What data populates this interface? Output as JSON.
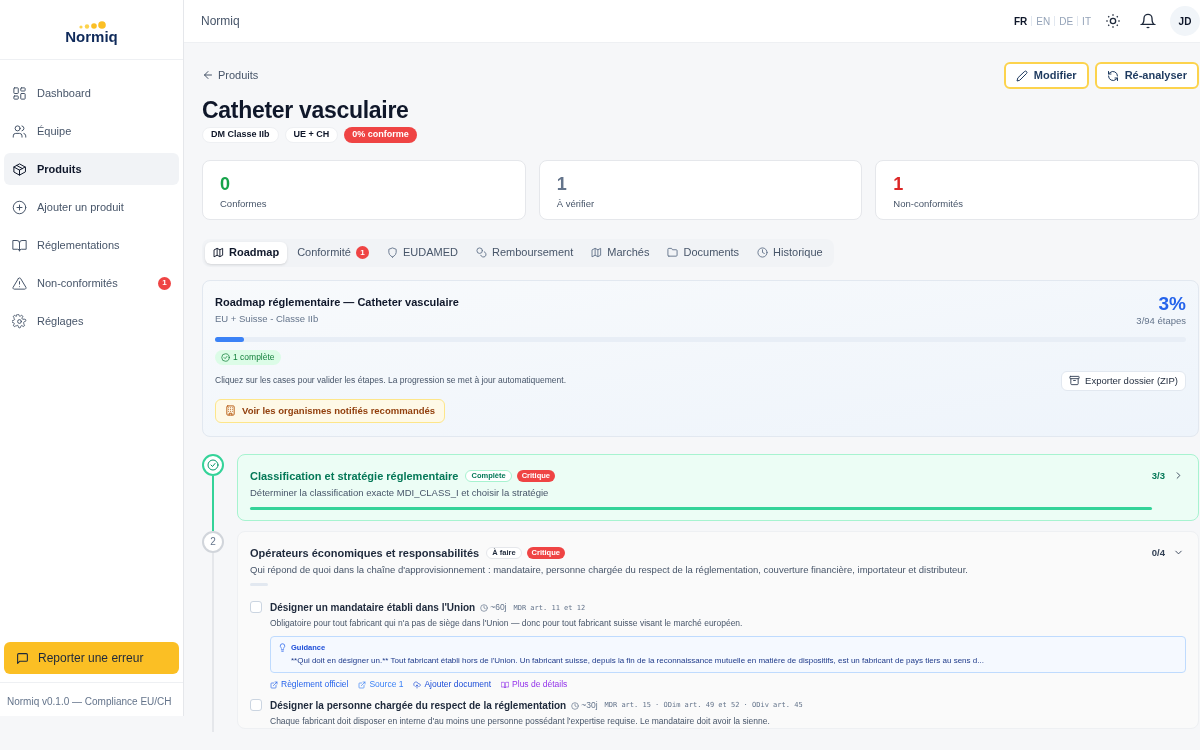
{
  "app": {
    "logo": "Normiq",
    "breadcrumb": "Normiq",
    "user_initials": "JD"
  },
  "languages": [
    {
      "label": "FR",
      "selected": true
    },
    {
      "label": "EN",
      "selected": false
    },
    {
      "label": "DE",
      "selected": false
    },
    {
      "label": "IT",
      "selected": false
    }
  ],
  "sidebar": {
    "items": [
      {
        "label": "Dashboard",
        "selected": false
      },
      {
        "label": "Équipe",
        "selected": false
      },
      {
        "label": "Produits",
        "selected": true
      },
      {
        "label": "Ajouter un produit",
        "selected": false
      },
      {
        "label": "Réglementations",
        "selected": false
      },
      {
        "label": "Non-conformités",
        "selected": false,
        "badge": "1"
      },
      {
        "label": "Réglages",
        "selected": false
      }
    ],
    "report_button": "Reporter une erreur",
    "footer": "Normiq v0.1.0 — Compliance EU/CH"
  },
  "product": {
    "back_link": "Produits",
    "title": "Catheter vasculaire",
    "tags": [
      {
        "label": "DM Classe IIb",
        "kind": "plain"
      },
      {
        "label": "UE + CH",
        "kind": "plain"
      },
      {
        "label": "0% conforme",
        "kind": "danger"
      }
    ],
    "actions": [
      "Modifier",
      "Ré-analyser"
    ]
  },
  "stats": [
    {
      "value": "0",
      "label": "Conformes",
      "color": "#16a34a"
    },
    {
      "value": "1",
      "label": "À vérifier",
      "color": "#64748b"
    },
    {
      "value": "1",
      "label": "Non-conformités",
      "color": "#dc2626"
    }
  ],
  "tabs": [
    {
      "label": "Roadmap",
      "selected": true
    },
    {
      "label": "Conformité",
      "selected": false,
      "badge": "1"
    },
    {
      "label": "EUDAMED",
      "selected": false
    },
    {
      "label": "Remboursement",
      "selected": false
    },
    {
      "label": "Marchés",
      "selected": false
    },
    {
      "label": "Documents",
      "selected": false
    },
    {
      "label": "Historique",
      "selected": false
    }
  ],
  "roadmap": {
    "title": "Roadmap réglementaire — Catheter vasculaire",
    "subtitle": "EU + Suisse - Classe IIb",
    "percent": "3%",
    "steps_count": "3/94 étapes",
    "level": 0.03,
    "complete_badge": "1 complète",
    "hint": "Cliquez sur les cases pour valider les étapes. La progression se met à jour automatiquement.",
    "export_button": "Exporter dossier (ZIP)",
    "notified_button": "Voir les organismes notifiés recommandés"
  },
  "steps": [
    {
      "kind": "complete",
      "title": "Classification et stratégie réglementaire",
      "status_label": "Complète",
      "priority": "Critique",
      "description": "Déterminer la classification exacte MDI_CLASS_I et choisir la stratégie",
      "progress": "3/3",
      "level": 1,
      "expanded": false
    },
    {
      "kind": "todo",
      "number": "2",
      "title": "Opérateurs économiques et responsabilités",
      "status_label": "À faire",
      "priority": "Critique",
      "description": "Qui répond de quoi dans la chaîne d'approvisionnement : mandataire, personne chargée du respect de la réglementation, couverture financière, importateur et distributeur.",
      "progress": "0/4",
      "level": 0,
      "expanded": true,
      "tasks": [
        {
          "title": "Désigner un mandataire établi dans l'Union",
          "checked": false,
          "duration": "~60j",
          "refs": "MDR art. 11 et 12",
          "description": "Obligatoire pour tout fabricant qui n'a pas de siège dans l'Union — donc pour tout fabricant suisse visant le marché européen.",
          "guidance": {
            "title": "Guidance",
            "text": "**Qui doit en désigner un.** Tout fabricant établi hors de l'Union. Un fabricant suisse, depuis la fin de la reconnaissance mutuelle en matière de dispositifs, est un fabricant de pays tiers au sens d..."
          },
          "links": [
            {
              "label": "Règlement officiel",
              "kind": "external"
            },
            {
              "label": "Source 1",
              "kind": "source"
            },
            {
              "label": "Ajouter document",
              "kind": "upload"
            },
            {
              "label": "Plus de détails",
              "kind": "details"
            }
          ]
        },
        {
          "title": "Désigner la personne chargée du respect de la réglementation",
          "checked": false,
          "duration": "~30j",
          "refs": "MDR art. 15 · ODim art. 49 et 52 · ODiv art. 45",
          "description": "Chaque fabricant doit disposer en interne d'au moins une personne possédant l'expertise requise. Le mandataire doit avoir la sienne."
        }
      ]
    }
  ]
}
